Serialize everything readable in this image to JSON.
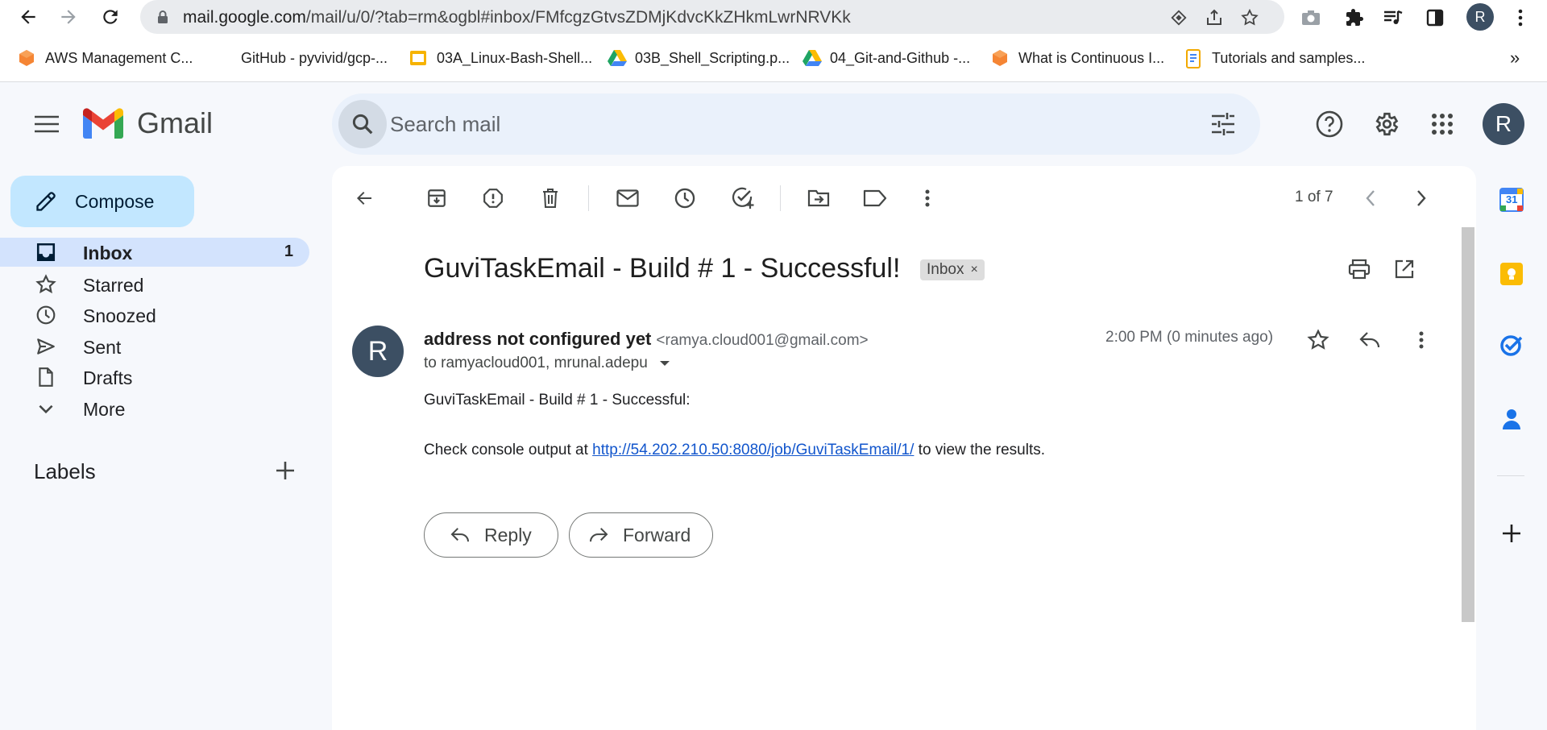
{
  "browser": {
    "url_host": "mail.google.com",
    "url_path": "/mail/u/0/?tab=rm&ogbl#inbox/FMfcgzGtvsZDMjKdvcKkZHkmLwrNRVKk",
    "profile_initial": "R",
    "bookmarks": [
      {
        "label": "AWS Management C...",
        "icon": "aws-icon"
      },
      {
        "label": "GitHub - pyvivid/gcp-...",
        "icon": "none"
      },
      {
        "label": "03A_Linux-Bash-Shell...",
        "icon": "slides-icon"
      },
      {
        "label": "03B_Shell_Scripting.p...",
        "icon": "drive-icon"
      },
      {
        "label": "04_Git-and-Github -...",
        "icon": "drive-icon"
      },
      {
        "label": "What is Continuous I...",
        "icon": "aws-icon"
      },
      {
        "label": "Tutorials and samples...",
        "icon": "doc-icon"
      }
    ],
    "more_bookmarks": "»"
  },
  "header": {
    "app_name": "Gmail",
    "search_placeholder": "Search mail",
    "account_initial": "R"
  },
  "sidebar": {
    "compose_label": "Compose",
    "items": [
      {
        "label": "Inbox",
        "count": "1",
        "icon": "inbox-icon"
      },
      {
        "label": "Starred",
        "count": "",
        "icon": "star-icon"
      },
      {
        "label": "Snoozed",
        "count": "",
        "icon": "clock-icon"
      },
      {
        "label": "Sent",
        "count": "",
        "icon": "send-icon"
      },
      {
        "label": "Drafts",
        "count": "",
        "icon": "draft-icon"
      },
      {
        "label": "More",
        "count": "",
        "icon": "chevron-down-icon"
      }
    ],
    "labels_heading": "Labels"
  },
  "toolbar": {
    "pager": "1 of 7"
  },
  "message": {
    "subject": "GuviTaskEmail - Build # 1 - Successful!",
    "tag": "Inbox",
    "tag_close": "×",
    "sender_initial": "R",
    "sender_name": "address not configured yet",
    "sender_email": "<ramya.cloud001@gmail.com>",
    "to": "to ramyacloud001, mrunal.adepu",
    "time": "2:00 PM (0 minutes ago)",
    "body_line1": "GuviTaskEmail - Build # 1 - Successful:",
    "body_line2_prefix": "Check console output at ",
    "body_link": "http://54.202.210.50:8080/job/GuviTaskEmail/1/",
    "body_line2_suffix": " to view the results.",
    "reply_label": "Reply",
    "forward_label": "Forward"
  },
  "side_panel": {
    "calendar_day": "31"
  },
  "colors": {
    "accent_blue": "#0b57d0",
    "compose_bg": "#c2e7ff",
    "active_nav": "#d3e3fd",
    "avatar": "#3c4f63"
  }
}
